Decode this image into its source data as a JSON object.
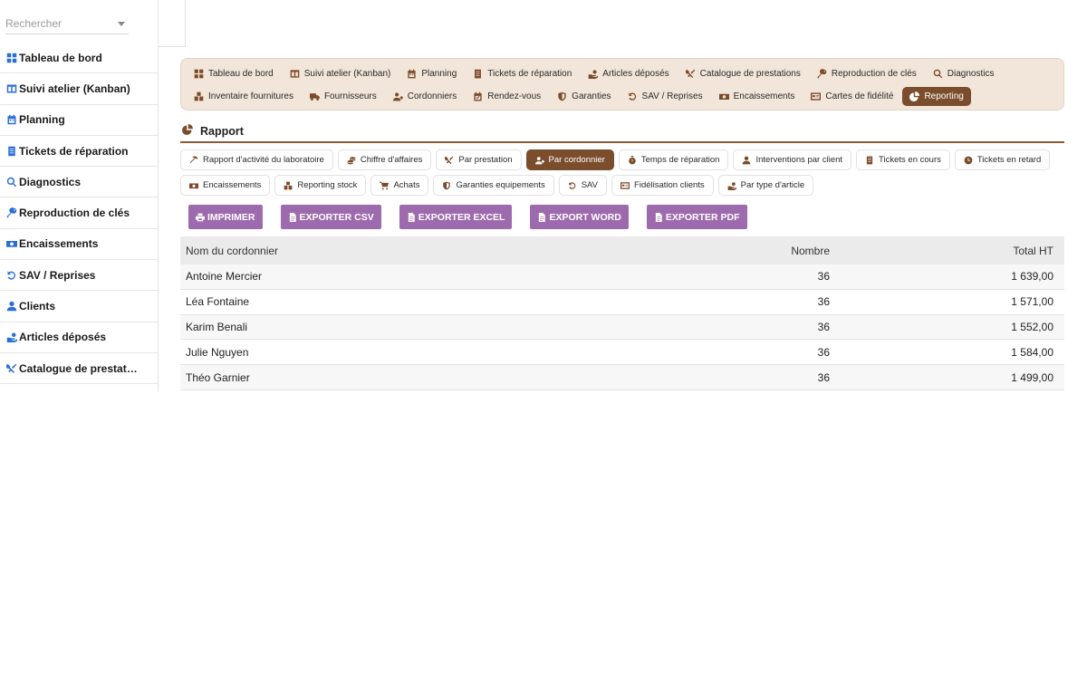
{
  "search": {
    "placeholder": "Rechercher"
  },
  "sidebar": {
    "items": [
      {
        "label": "Tableau de bord",
        "icon": "grid-icon"
      },
      {
        "label": "Suivi atelier (Kanban)",
        "icon": "columns-icon"
      },
      {
        "label": "Planning",
        "icon": "calendar-icon"
      },
      {
        "label": "Tickets de réparation",
        "icon": "ticket-icon"
      },
      {
        "label": "Diagnostics",
        "icon": "search-icon"
      },
      {
        "label": "Reproduction de clés",
        "icon": "key-icon"
      },
      {
        "label": "Encaissements",
        "icon": "money-icon"
      },
      {
        "label": "SAV / Reprises",
        "icon": "undo-icon"
      },
      {
        "label": "Clients",
        "icon": "user-icon"
      },
      {
        "label": "Articles déposés",
        "icon": "hand-icon"
      },
      {
        "label": "Catalogue de prestat…",
        "icon": "tools-icon"
      }
    ]
  },
  "topnav": {
    "row1": [
      {
        "label": "Tableau de bord",
        "icon": "grid-icon"
      },
      {
        "label": "Suivi atelier (Kanban)",
        "icon": "columns-icon"
      },
      {
        "label": "Planning",
        "icon": "calendar-icon"
      },
      {
        "label": "Tickets de réparation",
        "icon": "ticket-icon"
      },
      {
        "label": "Articles déposés",
        "icon": "hand-icon"
      },
      {
        "label": "Catalogue de prestations",
        "icon": "tools-icon"
      },
      {
        "label": "Reproduction de clés",
        "icon": "key-icon"
      },
      {
        "label": "Diagnostics",
        "icon": "search-icon"
      }
    ],
    "row2": [
      {
        "label": "Inventaire fournitures",
        "icon": "boxes-icon"
      },
      {
        "label": "Fournisseurs",
        "icon": "truck-icon"
      },
      {
        "label": "Cordonniers",
        "icon": "users-icon"
      },
      {
        "label": "Rendez-vous",
        "icon": "calendar-check-icon"
      },
      {
        "label": "Garanties",
        "icon": "shield-icon"
      },
      {
        "label": "SAV / Reprises",
        "icon": "undo-icon"
      },
      {
        "label": "Encaissements",
        "icon": "money-icon"
      },
      {
        "label": "Cartes de fidélité",
        "icon": "card-icon"
      },
      {
        "label": "Reporting",
        "icon": "pie-icon",
        "active": true
      }
    ]
  },
  "section": {
    "title": "Rapport",
    "icon": "pie-icon"
  },
  "tabs": {
    "row1": [
      {
        "label": "Rapport d'activité du laboratoire",
        "icon": "hammer-icon"
      },
      {
        "label": "Chiffre d'affaires",
        "icon": "coins-icon"
      },
      {
        "label": "Par prestation",
        "icon": "tools-icon"
      },
      {
        "label": "Par cordonnier",
        "icon": "users-icon",
        "active": true
      },
      {
        "label": "Temps de réparation",
        "icon": "stopwatch-icon"
      },
      {
        "label": "Interventions par client",
        "icon": "user-icon"
      },
      {
        "label": "Tickets en cours",
        "icon": "ticket-icon"
      },
      {
        "label": "Tickets en retard",
        "icon": "clock-icon"
      }
    ],
    "row2": [
      {
        "label": "Encaissements",
        "icon": "money-icon"
      },
      {
        "label": "Reporting stock",
        "icon": "boxes-icon"
      },
      {
        "label": "Achats",
        "icon": "cart-icon"
      },
      {
        "label": "Garanties equipements",
        "icon": "shield-icon"
      },
      {
        "label": "SAV",
        "icon": "undo-icon"
      },
      {
        "label": "Fidélisation clients",
        "icon": "card-icon"
      },
      {
        "label": "Par type d'article",
        "icon": "hand-icon"
      }
    ]
  },
  "exports": [
    {
      "label": "IMPRIMER",
      "icon": "print-icon"
    },
    {
      "label": "EXPORTER CSV",
      "icon": "file-icon"
    },
    {
      "label": "EXPORTER EXCEL",
      "icon": "file-icon"
    },
    {
      "label": "EXPORT WORD",
      "icon": "file-icon"
    },
    {
      "label": "EXPORTER PDF",
      "icon": "file-icon"
    }
  ],
  "table": {
    "headers": [
      "Nom du cordonnier",
      "Nombre",
      "Total HT"
    ],
    "rows": [
      [
        "Antoine Mercier",
        "36",
        "1 639,00"
      ],
      [
        "Léa Fontaine",
        "36",
        "1 571,00"
      ],
      [
        "Karim Benali",
        "36",
        "1 552,00"
      ],
      [
        "Julie Nguyen",
        "36",
        "1 584,00"
      ],
      [
        "Théo Garnier",
        "36",
        "1 499,00"
      ]
    ]
  },
  "colors": {
    "accent": "#7a4e2c",
    "nav_bg": "#f2e5d9",
    "export_btn": "#9d6bad",
    "sidebar_icon": "#2a6fd6"
  }
}
